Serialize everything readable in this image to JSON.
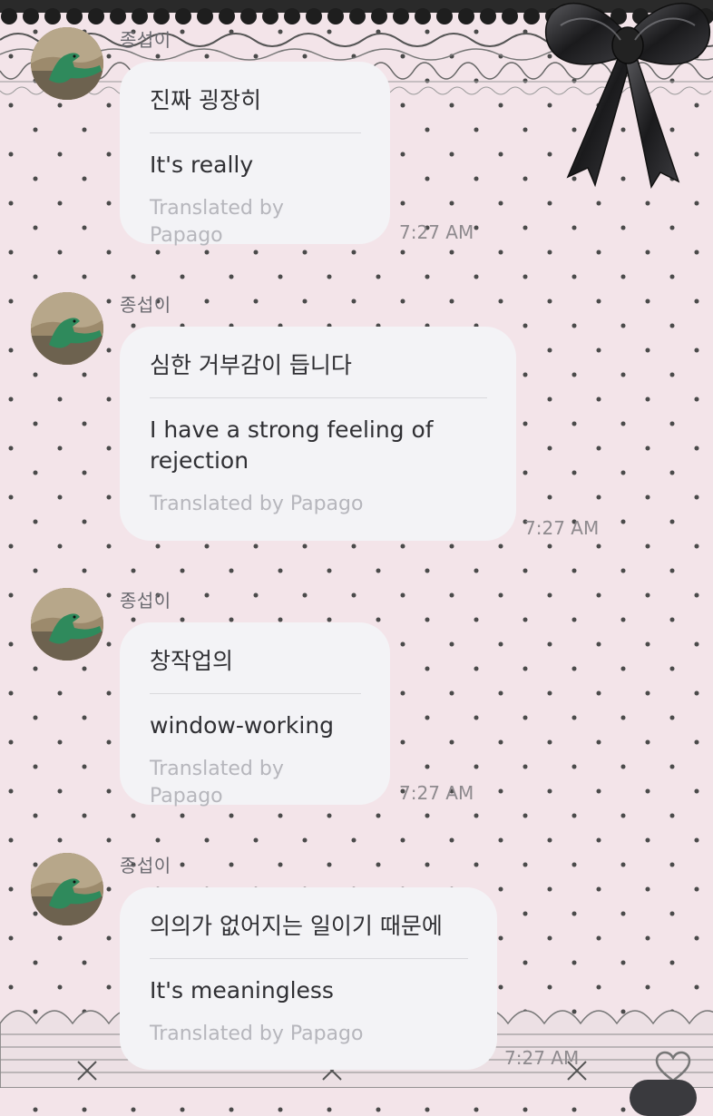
{
  "chat": {
    "messages": [
      {
        "sender": "종섭이",
        "original": "진짜 굉장히",
        "translation": "It's really",
        "translated_by": "Translated by Papago",
        "time": "7:27 AM"
      },
      {
        "sender": "종섭이",
        "original": "심한 거부감이 듭니다",
        "translation": "I have a strong feeling of rejection",
        "translated_by": "Translated by Papago",
        "time": "7:27 AM"
      },
      {
        "sender": "종섭이",
        "original": "창작업의",
        "translation": "window-working",
        "translated_by": "Translated by Papago",
        "time": "7:27 AM"
      },
      {
        "sender": "종섭이",
        "original": "의의가 없어지는 일이기 때문에",
        "translation": "It's meaningless",
        "translated_by": "Translated by Papago",
        "time": "7:27 AM"
      }
    ]
  },
  "icons": {
    "avatar": "avatar-dinosaur-image",
    "like": "heart-outline-icon",
    "decoration": "black-bow-icon"
  },
  "colors": {
    "background": "#f3e4e9",
    "bubble": "#f3f3f6",
    "text": "#2f2f33",
    "muted": "#b6b6bc",
    "polka_dot": "#4a4a4a"
  }
}
